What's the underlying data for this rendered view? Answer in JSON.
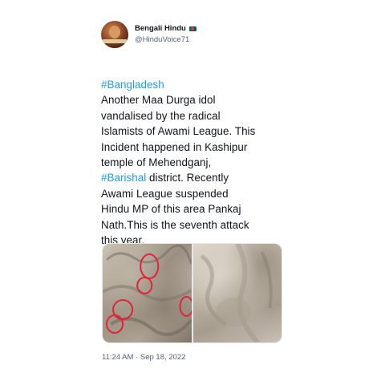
{
  "tweet": {
    "author": {
      "display_name": "Bengali Hindu",
      "handle": "@HinduVoice71",
      "flag_icon": "bangladesh-flag-icon"
    },
    "text_lines": [
      {
        "hashtag": "#Bangladesh",
        "text": ""
      },
      {
        "hashtag": "",
        "text": "Another Maa Durga idol"
      },
      {
        "hashtag": "",
        "text": "vandalised by the radical"
      },
      {
        "hashtag": "",
        "text": "Islamists of Awami League. This"
      },
      {
        "hashtag": "",
        "text": "Incident happened in Kashipur"
      },
      {
        "hashtag": "",
        "text": "temple of Mehendganj,"
      },
      {
        "hashtag": "#Barishal",
        "text": " district. Recently"
      },
      {
        "hashtag": "",
        "text": "Awami League suspended"
      },
      {
        "hashtag": "",
        "text": "Hindu MP of this area Pankaj"
      },
      {
        "hashtag": "",
        "text": "Nath.This is the seventh attack"
      },
      {
        "hashtag": "",
        "text": "this year."
      }
    ],
    "timestamp": "11:24 AM · Sep 18, 2022",
    "colors": {
      "text": "#0f1419",
      "link": "#1d9bf0",
      "muted": "#536471",
      "annotation_circle": "#e0243a"
    }
  }
}
